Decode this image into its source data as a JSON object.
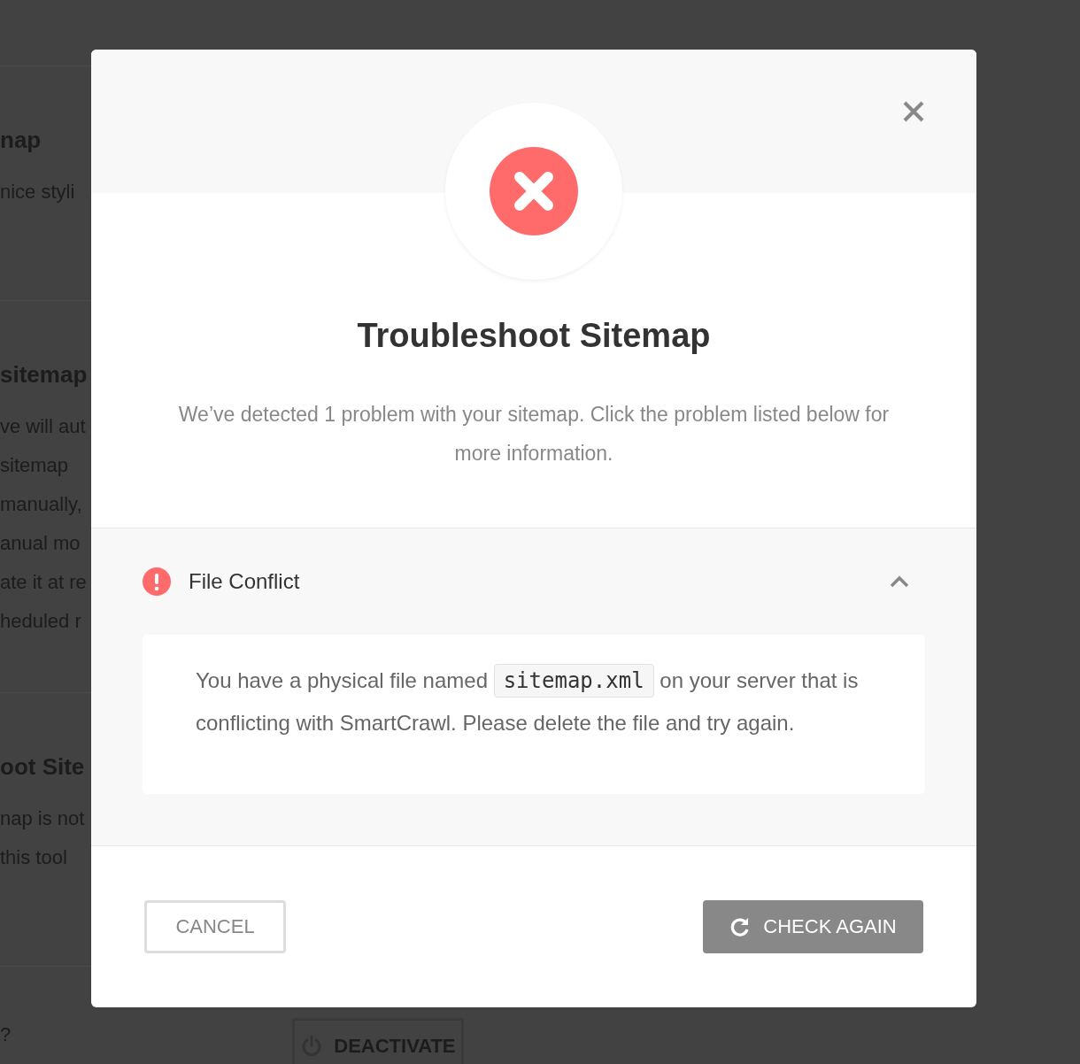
{
  "background": {
    "sections": [
      {
        "title": "nap",
        "lines": [
          "nice styli"
        ]
      },
      {
        "title": "sitemap",
        "lines": [
          "ve will aut",
          "sitemap",
          "manually,",
          "anual mo",
          "ate it at re",
          "heduled r"
        ]
      },
      {
        "title": "oot Site",
        "lines": [
          "nap is not",
          "this tool"
        ]
      }
    ],
    "footer_text": "?",
    "deactivate_button": "DEACTIVATE"
  },
  "modal": {
    "title": "Troubleshoot Sitemap",
    "description": "We’ve detected 1 problem with your sitemap. Click the problem listed below for more information.",
    "problems": [
      {
        "title": "File Conflict",
        "expanded": true,
        "text_before": "You have a physical file named",
        "code": "sitemap.xml",
        "text_after": "on your server that is conflicting with SmartCrawl. Please delete the file and try again."
      }
    ],
    "cancel_button": "CANCEL",
    "check_button": "CHECK AGAIN"
  }
}
